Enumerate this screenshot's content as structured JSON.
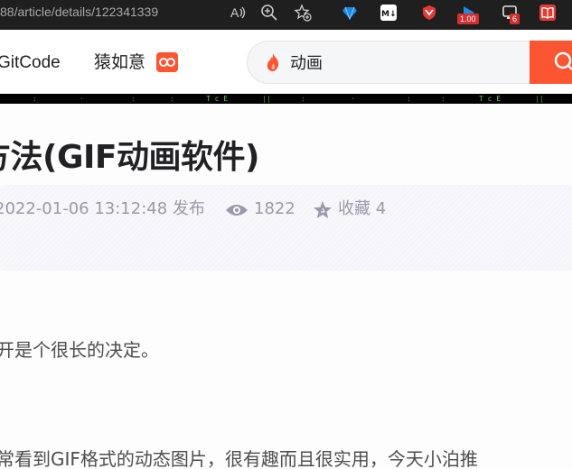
{
  "browser": {
    "url": "88/article/details/122341339",
    "icons": [
      "read-aloud-icon",
      "zoom-icon",
      "add-favorite-icon"
    ],
    "extensions": [
      {
        "name": "gem-extension-icon",
        "color": "#1e88e5"
      },
      {
        "name": "markdown-extension-icon",
        "color": "#ffffff"
      },
      {
        "name": "shield-extension-icon",
        "color": "#e53935"
      },
      {
        "name": "speed-extension-icon",
        "color": "#1e88e5",
        "badge": "1.00"
      },
      {
        "name": "monitor-extension-icon",
        "color": "#e0e0e0",
        "badge": "6"
      },
      {
        "name": "book-extension-icon",
        "color": "#e53935"
      }
    ]
  },
  "header": {
    "gitcode_label": "GitCode",
    "yuanruyi_label": "猿如意",
    "search_value": "动画"
  },
  "article": {
    "title": "方法(GIF动画软件)",
    "date": "2022-01-06 13:12:48 发布",
    "views": "1822",
    "favorites": "收藏 4",
    "para1": "开是个很长的决定。",
    "para2": "常看到GIF格式的动态图片，很有趣而且很实用，今天小泊推"
  },
  "colors": {
    "accent": "#fc5531",
    "chrome": "#1f1f1f",
    "meta": "#999aaa"
  }
}
